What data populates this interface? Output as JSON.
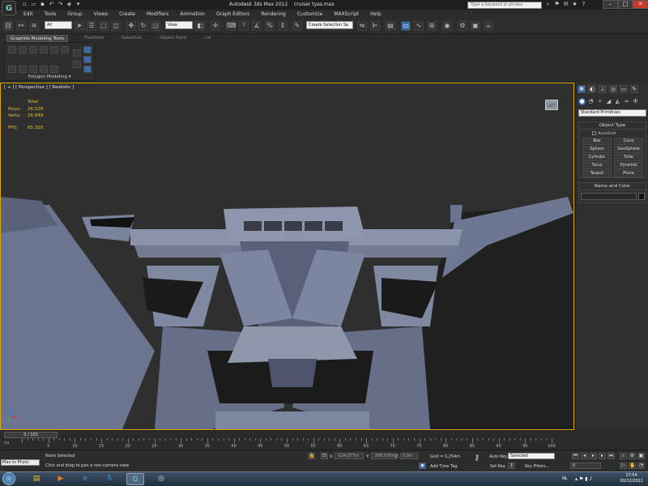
{
  "title_bar": {
    "app_title": "Autodesk 3ds Max  2012",
    "file_name": "cruiser tyas.max",
    "search_placeholder": "Type a keyword or phrase",
    "window_controls": [
      "–",
      "□",
      "✕"
    ]
  },
  "menu": [
    "Edit",
    "Tools",
    "Group",
    "Views",
    "Create",
    "Modifiers",
    "Animation",
    "Graph Editors",
    "Rendering",
    "Customize",
    "MAXScript",
    "Help"
  ],
  "toolbar": {
    "selection_filter": "All",
    "reference_coord": "View",
    "named_selection": "Create Selection Se"
  },
  "ribbon": {
    "tabs": [
      "Graphite Modeling Tools",
      "Freeform",
      "Selection",
      "Object Paint"
    ],
    "active_tab": "Graphite Modeling Tools",
    "panel_label": "Polygon Modeling ▾"
  },
  "viewport": {
    "label": "[ + ] [ Perspective ] [ Realistic ]",
    "stats": {
      "header": "Total",
      "polys_label": "Polys:",
      "polys_value": "26.528",
      "verts_label": "Verts:",
      "verts_value": "26.849",
      "fps_label": "FPS:",
      "fps_value": "65.320"
    },
    "viewcube_label": "LEFT"
  },
  "command_panel": {
    "primitives_dropdown": "Standard Primitives",
    "object_type_title": "Object Type",
    "autogrid_label": "AutoGrid",
    "object_buttons": [
      "Box",
      "Cone",
      "Sphere",
      "GeoSphere",
      "Cylinder",
      "Tube",
      "Torus",
      "Pyramid",
      "Teapot",
      "Plane"
    ],
    "name_color_title": "Name and Color"
  },
  "timeline": {
    "slider_label": "0 / 100",
    "ticks": [
      "5",
      "10",
      "15",
      "20",
      "25",
      "30",
      "35",
      "40",
      "45",
      "50",
      "55",
      "60",
      "65",
      "70",
      "75",
      "80",
      "85",
      "90",
      "95",
      "100"
    ]
  },
  "status": {
    "maxscript": "Max to Physc",
    "selection": "None Selected",
    "prompt": "Click and drag to pan a non-camera view",
    "x_label": "X:",
    "x_value": "-124,073m",
    "y_label": "Y:",
    "y_value": "-268,039m",
    "z_label": "Z:",
    "z_value": "0,0m",
    "grid": "Grid = 0,254m",
    "add_time_tag": "Add Time Tag",
    "auto_key": "Auto Key",
    "set_key": "Set Key",
    "key_mode": "Selected",
    "key_filters": "Key Filters...",
    "frame": "0"
  },
  "taskbar": {
    "language": "NL",
    "time": "17:54",
    "date": "30/12/2011"
  },
  "colors": {
    "viewport_border": "#d8a800",
    "stats_text": "#e5c233",
    "active_blue": "#3c6fb0"
  }
}
